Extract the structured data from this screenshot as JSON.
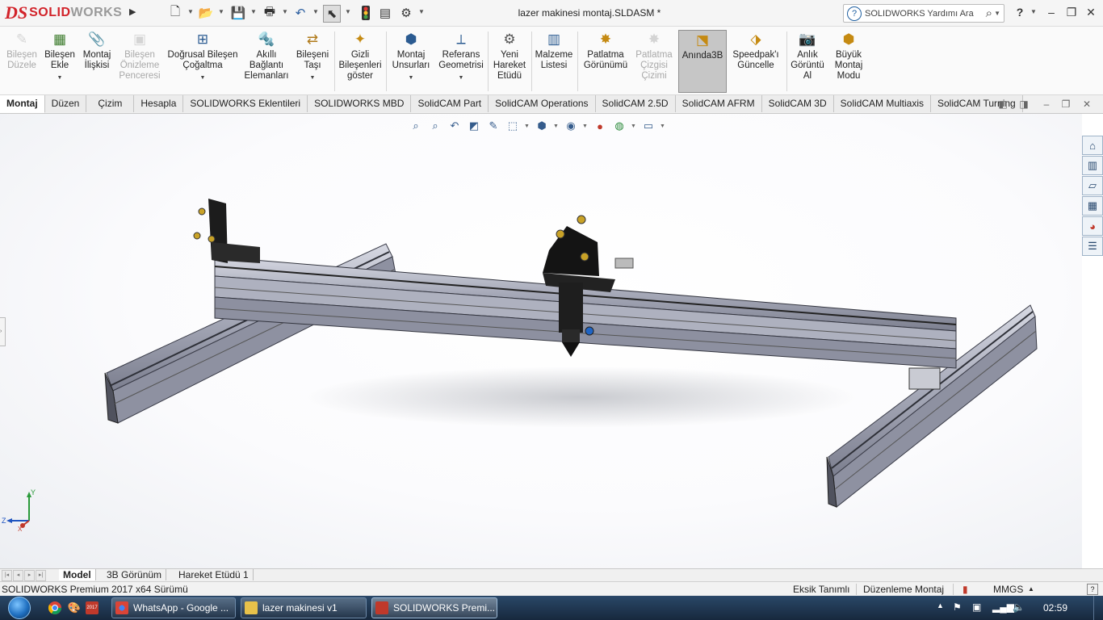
{
  "titlebar": {
    "logo_ds": "DS",
    "logo_solid": "SOLID",
    "logo_works": "WORKS",
    "document_title": "lazer makinesi montaj.SLDASM *",
    "help_search_placeholder": "SOLIDWORKS Yardımı Ara",
    "help_label": "?",
    "quick_access_icons": [
      "new-document-icon",
      "open-folder-icon",
      "save-icon",
      "print-icon",
      "undo-icon",
      "select-cursor-icon",
      "rebuild-traffic-light-icon",
      "file-properties-icon",
      "options-gear-icon"
    ]
  },
  "ribbon": {
    "buttons": [
      {
        "label": "Bileşen Düzele",
        "icon": "edit-component-icon",
        "disabled": true
      },
      {
        "label": "Bileşen Ekle",
        "icon": "insert-component-icon",
        "disabled": false,
        "caret": true
      },
      {
        "label": "Montaj İlişkisi",
        "icon": "mate-paperclip-icon",
        "disabled": false
      },
      {
        "label": "Bileşen Önizleme Penceresi",
        "icon": "component-preview-icon",
        "disabled": true
      },
      {
        "label": "Doğrusal Bileşen Çoğaltma",
        "icon": "linear-pattern-icon",
        "disabled": false,
        "caret": true
      },
      {
        "label": "Akıllı Bağlantı Elemanları",
        "icon": "smart-fasteners-icon",
        "disabled": false
      },
      {
        "label": "Bileşeni Taşı",
        "icon": "move-component-icon",
        "disabled": false,
        "caret": true
      },
      {
        "label": "Gizli Bileşenleri göster",
        "icon": "show-hidden-icon",
        "disabled": false
      },
      {
        "label": "Montaj Unsurları",
        "icon": "assembly-features-icon",
        "disabled": false,
        "caret": true
      },
      {
        "label": "Referans Geometrisi",
        "icon": "reference-geometry-icon",
        "disabled": false,
        "caret": true
      },
      {
        "label": "Yeni Hareket Etüdü",
        "icon": "new-motion-study-icon",
        "disabled": false
      },
      {
        "label": "Malzeme Listesi",
        "icon": "bill-of-materials-icon",
        "disabled": false
      },
      {
        "label": "Patlatma Görünümü",
        "icon": "exploded-view-icon",
        "disabled": false
      },
      {
        "label": "Patlatma Çizgisi Çizimi",
        "icon": "explode-line-sketch-icon",
        "disabled": true
      },
      {
        "label": "Anında3B",
        "icon": "instant3d-icon",
        "disabled": false,
        "active": true
      },
      {
        "label": "Speedpak'ı Güncelle",
        "icon": "update-speedpak-icon",
        "disabled": false
      },
      {
        "label": "Anlık Görüntü Al",
        "icon": "take-snapshot-camera-icon",
        "disabled": false
      },
      {
        "label": "Büyük Montaj Modu",
        "icon": "large-assembly-mode-icon",
        "disabled": false
      }
    ]
  },
  "tabs": [
    "Montaj",
    "Düzen",
    "Çizim",
    "Hesapla",
    "SOLIDWORKS Eklentileri",
    "SOLIDWORKS MBD",
    "SolidCAM Part",
    "SolidCAM Operations",
    "SolidCAM 2.5D",
    "SolidCAM AFRM",
    "SolidCAM 3D",
    "SolidCAM Multiaxis",
    "SolidCAM Turning"
  ],
  "selected_tab": "Montaj",
  "bottom_tabs": [
    "Model",
    "3B Görünüm",
    "Hareket Etüdü 1"
  ],
  "selected_bottom_tab": "Model",
  "statusbar": {
    "version": "SOLIDWORKS Premium 2017 x64 Sürümü",
    "under_defined": "Eksik Tanımlı",
    "mode": "Düzenleme Montaj",
    "units": "MMGS"
  },
  "triad": {
    "x": "X",
    "y": "Y",
    "z": "Z"
  },
  "taskbar": {
    "items": [
      {
        "label": "WhatsApp - Google ...",
        "icon": "chrome-icon"
      },
      {
        "label": "lazer makinesi v1",
        "icon": "folder-icon"
      },
      {
        "label": "SOLIDWORKS Premi...",
        "icon": "solidworks-icon",
        "active": true
      }
    ],
    "clock": "02:59"
  },
  "colors": {
    "accent_red": "#d2232a",
    "frame_gray": "#a9acb8",
    "head_black": "#1a1a1a"
  }
}
